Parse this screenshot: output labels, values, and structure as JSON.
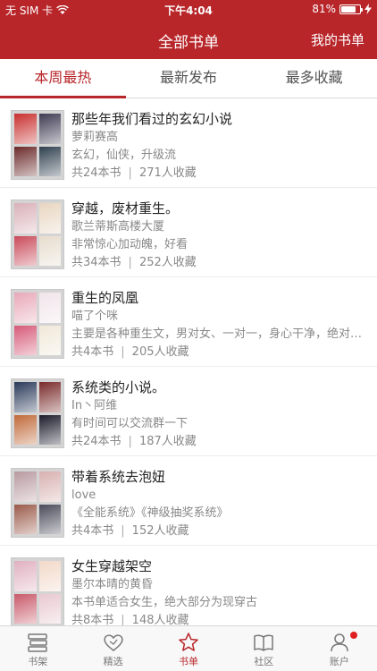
{
  "status_bar": {
    "carrier": "无 SIM 卡",
    "time": "下午4:04",
    "battery_text": "81%",
    "battery_level": 0.81
  },
  "nav": {
    "title": "全部书单",
    "right_button": "我的书单"
  },
  "tabs": [
    {
      "label": "本周最热",
      "active": true
    },
    {
      "label": "最新发布",
      "active": false
    },
    {
      "label": "最多收藏",
      "active": false
    }
  ],
  "booklists": [
    {
      "title": "那些年我们看过的玄幻小说",
      "author": "萝莉赛高",
      "desc": "玄幻，仙侠，升级流",
      "count": "共24本书",
      "favorites": "271人收藏",
      "cover_colors": [
        "#c8302e",
        "#3e3a52",
        "#6b2a2a",
        "#2f3f4e"
      ]
    },
    {
      "title": "穿越，废材重生。",
      "author": "歌兰蒂斯高楼大厦",
      "desc": "非常惊心加动魄，好看",
      "count": "共34本书",
      "favorites": "252人收藏",
      "cover_colors": [
        "#d9b0b8",
        "#e8d5c0",
        "#c94a5a",
        "#e6dccd"
      ]
    },
    {
      "title": "重生的凤凰",
      "author": "喵了个咪",
      "desc": "主要是各种重生文，男对女、一对一，身心干净，绝对宠文...",
      "count": "共4本书",
      "favorites": "205人收藏",
      "cover_colors": [
        "#e8a8b8",
        "#f1e4ea",
        "#d65a78",
        "#f0e8d8"
      ]
    },
    {
      "title": "系统类的小说。",
      "author": "In丶阿维",
      "desc": "有时间可以交流群一下",
      "count": "共24本书",
      "favorites": "187人收藏",
      "cover_colors": [
        "#2a3a5a",
        "#7a2a2a",
        "#c06a3a",
        "#1a1a2a"
      ]
    },
    {
      "title": "带着系统去泡妞",
      "author": "love",
      "desc": "《全能系统》《神级抽奖系统》",
      "count": "共4本书",
      "favorites": "152人收藏",
      "cover_colors": [
        "#b89aa0",
        "#d8b0b0",
        "#9a5a4a",
        "#4a4a5a"
      ]
    },
    {
      "title": "女生穿越架空",
      "author": "墨尔本晴的黄昏",
      "desc": "本书单适合女生，绝大部分为现穿古",
      "count": "共8本书",
      "favorites": "148人收藏",
      "cover_colors": [
        "#e0b0c0",
        "#f2d8c8",
        "#c85a6a",
        "#e8c8d0"
      ]
    }
  ],
  "tab_bar": [
    {
      "label": "书架",
      "icon": "bookshelf-icon",
      "active": false
    },
    {
      "label": "精选",
      "icon": "heart-icon",
      "active": false
    },
    {
      "label": "书单",
      "icon": "star-icon",
      "active": true
    },
    {
      "label": "社区",
      "icon": "open-book-icon",
      "active": false
    },
    {
      "label": "账户",
      "icon": "person-icon",
      "active": false,
      "badge": true
    }
  ],
  "colors": {
    "brand": "#b8262a",
    "badge": "#e02020",
    "secondary_text": "#888888"
  }
}
